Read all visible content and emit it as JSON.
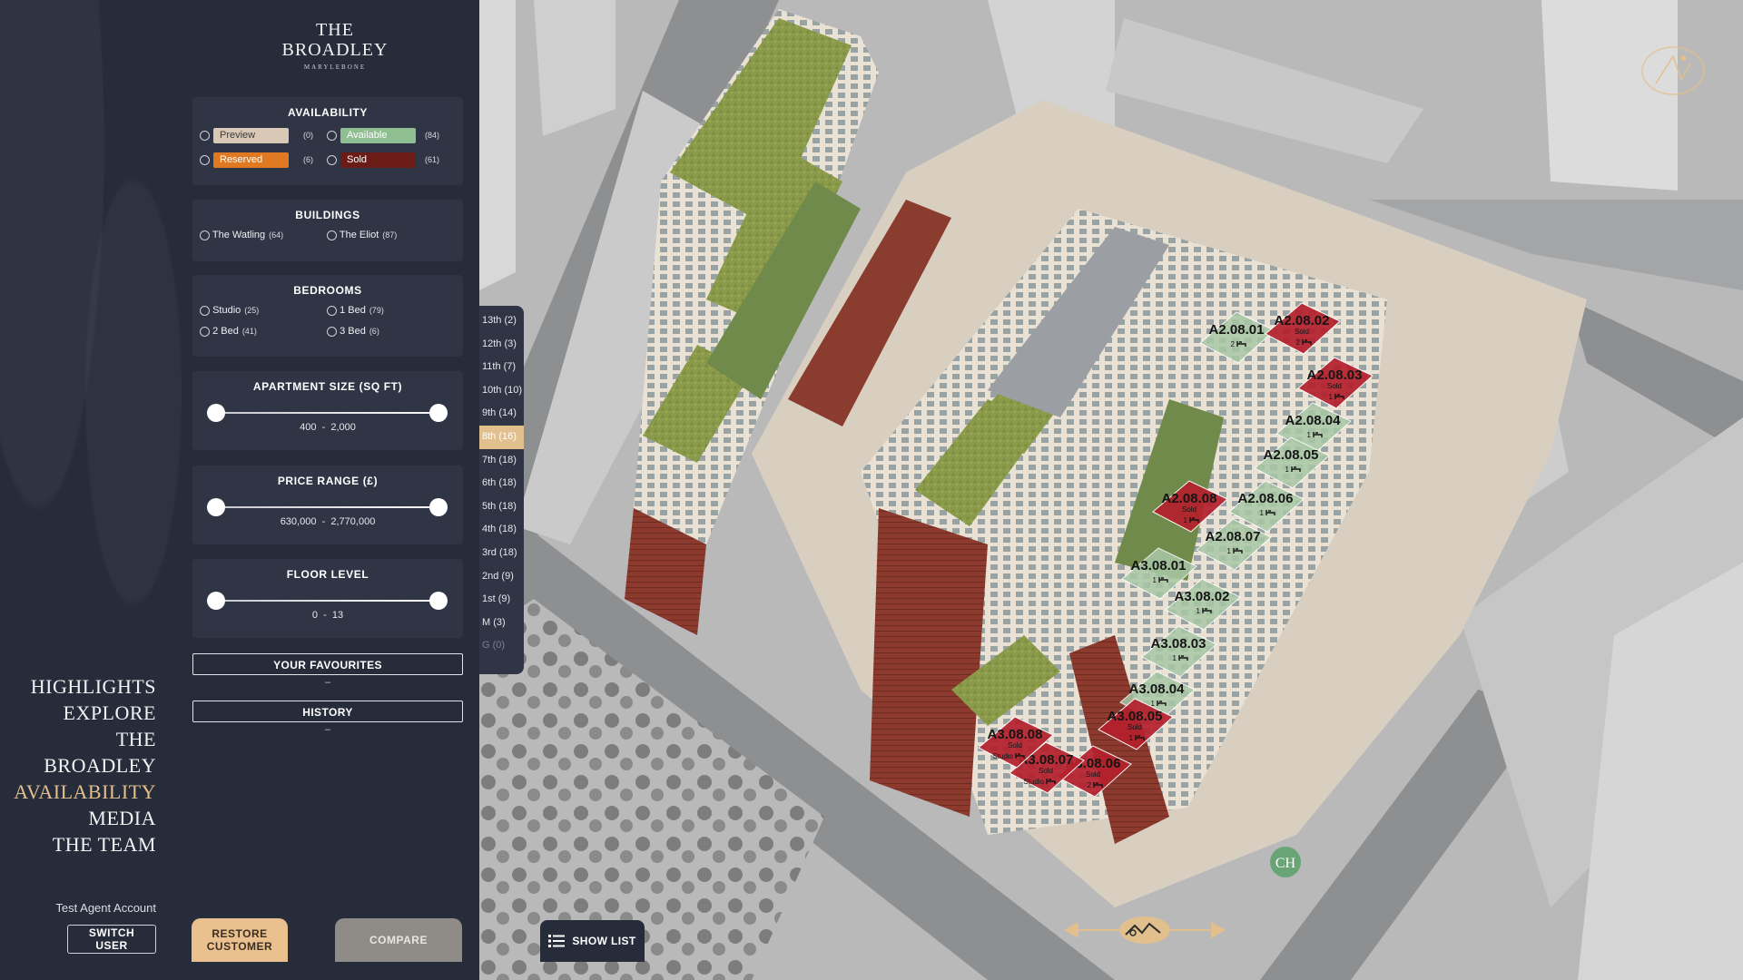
{
  "brand": {
    "line1": "THE",
    "line2": "BROADLEY",
    "tagline": "MARYLEBONE"
  },
  "nav": {
    "items": [
      {
        "label": "HIGHLIGHTS",
        "active": false
      },
      {
        "label": "EXPLORE",
        "active": false
      },
      {
        "label": "THE BROADLEY",
        "active": false
      },
      {
        "label": "AVAILABILITY",
        "active": true
      },
      {
        "label": "MEDIA",
        "active": false
      },
      {
        "label": "THE TEAM",
        "active": false
      }
    ],
    "account": "Test Agent Account",
    "switch_user": "SWITCH USER"
  },
  "filters": {
    "availability": {
      "title": "AVAILABILITY",
      "options": [
        {
          "label": "Preview",
          "count": "(0)",
          "color": "#d9c8b5",
          "text_color": "#3b3b3b"
        },
        {
          "label": "Available",
          "count": "(84)",
          "color": "#8fbe92",
          "text_color": "#ffffff"
        },
        {
          "label": "Reserved",
          "count": "(6)",
          "color": "#e07a22",
          "text_color": "#ffffff"
        },
        {
          "label": "Sold",
          "count": "(61)",
          "color": "#6b1c16",
          "text_color": "#ffffff"
        }
      ]
    },
    "buildings": {
      "title": "BUILDINGS",
      "options": [
        {
          "label": "The Watling",
          "count": "(64)"
        },
        {
          "label": "The Eliot",
          "count": "(87)"
        }
      ]
    },
    "bedrooms": {
      "title": "BEDROOMS",
      "options": [
        {
          "label": "Studio",
          "count": "(25)"
        },
        {
          "label": "1 Bed",
          "count": "(79)"
        },
        {
          "label": "2 Bed",
          "count": "(41)"
        },
        {
          "label": "3 Bed",
          "count": "(6)"
        }
      ]
    },
    "size": {
      "title": "APARTMENT SIZE (SQ FT)",
      "min": "400",
      "sep": "-",
      "max": "2,000"
    },
    "price": {
      "title": "PRICE RANGE (£)",
      "min": "630,000",
      "sep": "-",
      "max": "2,770,000"
    },
    "floor": {
      "title": "FLOOR LEVEL",
      "min": "0",
      "sep": "-",
      "max": "13"
    },
    "favourites": {
      "label": "YOUR FAVOURITES",
      "empty": "–"
    },
    "history": {
      "label": "HISTORY",
      "empty": "–"
    }
  },
  "actions": {
    "restore": "RESTORE CUSTOMER",
    "compare": "COMPARE"
  },
  "floors": [
    {
      "label": "13th (2)"
    },
    {
      "label": "12th (3)"
    },
    {
      "label": "11th (7)"
    },
    {
      "label": "10th (10)"
    },
    {
      "label": "9th (14)"
    },
    {
      "label": "8th (16)",
      "active": true
    },
    {
      "label": "7th (18)"
    },
    {
      "label": "6th (18)"
    },
    {
      "label": "5th (18)"
    },
    {
      "label": "4th (18)"
    },
    {
      "label": "3rd (18)"
    },
    {
      "label": "2nd (9)"
    },
    {
      "label": "1st (9)"
    },
    {
      "label": "M (3)"
    },
    {
      "label": "G (0)",
      "disabled": true
    }
  ],
  "show_list": "SHOW LIST",
  "units": [
    {
      "id": "A2.08.01",
      "status": "available",
      "beds": "2"
    },
    {
      "id": "A2.08.02",
      "status": "sold",
      "beds": "2"
    },
    {
      "id": "A2.08.03",
      "status": "sold",
      "beds": "1"
    },
    {
      "id": "A2.08.04",
      "status": "available",
      "beds": "1"
    },
    {
      "id": "A2.08.05",
      "status": "available",
      "beds": "1"
    },
    {
      "id": "A2.08.06",
      "status": "available",
      "beds": "1"
    },
    {
      "id": "A2.08.07",
      "status": "available",
      "beds": "1"
    },
    {
      "id": "A2.08.08",
      "status": "sold",
      "beds": "1"
    },
    {
      "id": "A3.08.01",
      "status": "available",
      "beds": "1"
    },
    {
      "id": "A3.08.02",
      "status": "available",
      "beds": "1"
    },
    {
      "id": "A3.08.03",
      "status": "available",
      "beds": "1"
    },
    {
      "id": "A3.08.04",
      "status": "available",
      "beds": "1"
    },
    {
      "id": "A3.08.05",
      "status": "sold",
      "beds": "1"
    },
    {
      "id": "A3.08.06",
      "status": "sold",
      "beds": "2"
    },
    {
      "id": "A3.08.07",
      "status": "sold",
      "beds": "Studio"
    },
    {
      "id": "A3.08.08",
      "status": "sold",
      "beds": "Studio"
    }
  ],
  "sold_text": "Sold",
  "colors": {
    "sold": "#b5202c",
    "available": "#a9c8a6",
    "accent": "#e2c08d",
    "panel": "#2f3545",
    "bg": "#272c3b"
  },
  "icons": [
    "compass-icon",
    "list-icon",
    "map-pan-icon",
    "bed-icon",
    "ch-logo-icon"
  ]
}
